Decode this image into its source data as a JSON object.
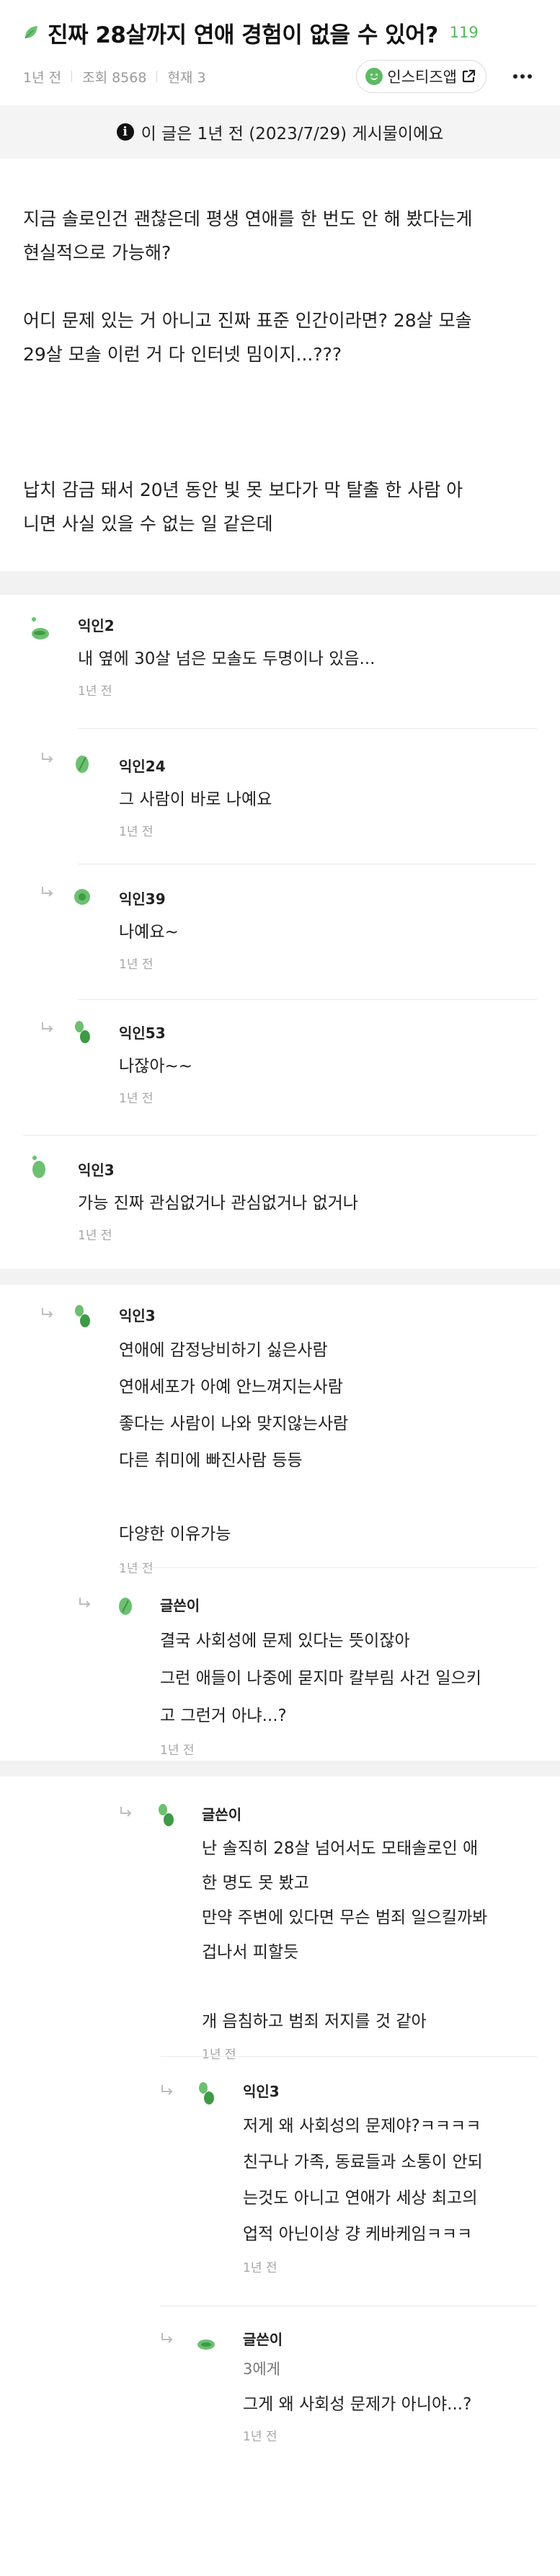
{
  "post": {
    "title": "진짜 28살까지 연애 경험이 없을 수 있어?",
    "comment_count": "119",
    "meta": [
      "1년 전",
      "조회 8568",
      "현재 3"
    ],
    "app_button": "인스티즈앱",
    "notice": "이 글은 1년 전 (2023/7/29) 게시물이에요",
    "body": [
      "지금 솔로인건 괜찮은데 평생 연애를 한 번도 안 해 봤다는게\n현실적으로 가능해?",
      "어디 문제 있는 거 아니고 진짜 표준 인간이라면? 28살 모솔\n29살 모솔 이런 거 다 인터넷 밈이지...???",
      "납치 감금 돼서 20년 동안 빛 못 보다가 막 탈출 한 사람 아\n니면 사실 있을 수 없는 일 같은데"
    ]
  },
  "comments": [
    {
      "nick": "익인2",
      "text": "내 옆에 30살 넘은 모솔도 두명이나 있음...",
      "time": "1년 전"
    },
    {
      "nick": "익인24",
      "text": "그 사람이 바로 나예요",
      "time": "1년 전"
    },
    {
      "nick": "익인39",
      "text": "나예요~",
      "time": "1년 전"
    },
    {
      "nick": "익인53",
      "text": "나잖아~~",
      "time": "1년 전"
    },
    {
      "nick": "익인3",
      "text": "가능 진짜 관심없거나 관심없거나 없거나",
      "time": "1년 전"
    },
    {
      "nick": "익인3",
      "text": "연애에 감정낭비하기 싫은사람\n연애세포가 아예 안느껴지는사람\n좋다는 사람이 나와 맞지않는사람\n다른 취미에 빠진사람 등등\n\n다양한 이유가능",
      "time": "1년 전"
    },
    {
      "nick": "글쓴이",
      "text": "결국 사회성에 문제 있다는 뜻이잖아\n그런 애들이 나중에 묻지마 칼부림 사건 일으키\n고 그런거 아냐...?",
      "time": "1년 전"
    },
    {
      "nick": "글쓴이",
      "text": "난 솔직히 28살 넘어서도 모태솔로인 애\n한 명도 못 봤고\n만약 주변에 있다면 무슨 범죄 일으킬까봐\n겁나서 피할듯\n\n개 음침하고 범죄 저지를 것 같아",
      "time": "1년 전"
    },
    {
      "nick": "익인3",
      "text": "저게 왜 사회성의 문제야?ㅋㅋㅋㅋ\n친구나 가족, 동료들과 소통이 안되\n는것도 아니고 연애가 세상 최고의\n업적 아닌이상 걍 케바케임ㅋㅋㅋ",
      "time": "1년 전"
    },
    {
      "nick": "글쓴이",
      "mention": "3에게",
      "text": "그게 왜 사회성 문제가 아니야...?",
      "time": "1년 전"
    }
  ],
  "colors": {
    "accent": "#56b85c",
    "background_gap": "#f2f2f2",
    "notice_bg": "#f4f4f4"
  },
  "icons": [
    "leaf-icon",
    "smile-icon",
    "external-link-icon",
    "more-dots-icon",
    "info-icon",
    "reply-arrow-icon"
  ]
}
